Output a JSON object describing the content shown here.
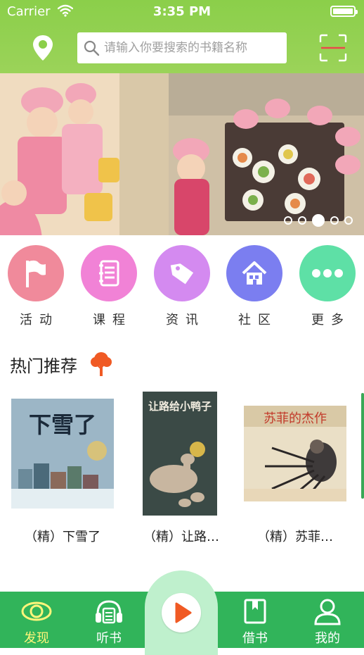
{
  "status_bar": {
    "carrier": "Carrier",
    "time": "3:35 PM"
  },
  "header": {
    "location_icon": "location-pin-icon",
    "search_placeholder": "请输入你要搜索的书籍名称",
    "scan_icon": "scan-icon",
    "color": "#8bcf4a"
  },
  "banner": {
    "dots": 5,
    "active_dot": 3
  },
  "categories": [
    {
      "label": "活动",
      "icon": "flag-icon",
      "color": "#f08a9b"
    },
    {
      "label": "课程",
      "icon": "notebook-icon",
      "color": "#f182d6"
    },
    {
      "label": "资讯",
      "icon": "tag-icon",
      "color": "#d48af0"
    },
    {
      "label": "社区",
      "icon": "house-icon",
      "color": "#7b7ef0"
    },
    {
      "label": "更多",
      "icon": "more-icon",
      "color": "#5ee0a6"
    }
  ],
  "hot": {
    "title": "热门推荐",
    "icon": "tree-icon",
    "books": [
      {
        "title": "（精）下雪了",
        "cover_text": "下雪了"
      },
      {
        "title": "（精）让路…",
        "cover_text": "让路给小鸭子"
      },
      {
        "title": "（精）苏菲…",
        "cover_text": "苏菲的杰作"
      }
    ]
  },
  "tabbar": {
    "tabs": [
      {
        "label": "发现",
        "icon": "eye-icon",
        "active": true
      },
      {
        "label": "听书",
        "icon": "headphones-icon",
        "active": false
      },
      {
        "label": "借书",
        "icon": "bookmark-book-icon",
        "active": false
      },
      {
        "label": "我的",
        "icon": "user-icon",
        "active": false
      }
    ],
    "center_icon": "play-icon",
    "color": "#31b45a",
    "active_color": "#fff57a"
  }
}
